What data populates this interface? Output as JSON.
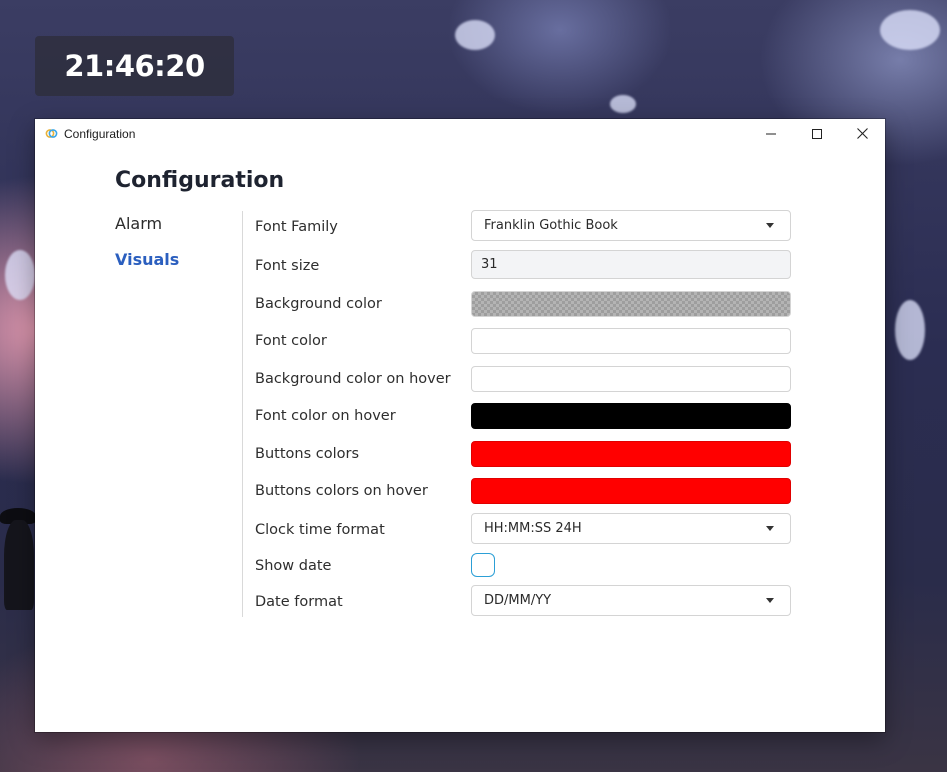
{
  "desktop": {
    "clock_overlay": "21:46:20"
  },
  "window": {
    "title": "Configuration",
    "app_icon": "link-rings-icon",
    "controls": [
      "minimize-icon",
      "maximize-icon",
      "close-icon"
    ]
  },
  "page": {
    "title": "Configuration"
  },
  "nav": {
    "items": [
      {
        "label": "Alarm",
        "active": false
      },
      {
        "label": "Visuals",
        "active": true
      }
    ],
    "active_color": "#2b5fbf"
  },
  "settings": {
    "font_family": {
      "label": "Font Family",
      "value": "Franklin Gothic Book"
    },
    "font_size": {
      "label": "Font size",
      "value": "31"
    },
    "background_color": {
      "label": "Background color",
      "color": "transparent"
    },
    "font_color": {
      "label": "Font color",
      "color": "#ffffff"
    },
    "background_color_hover": {
      "label": "Background color on hover",
      "color": "#ffffff"
    },
    "font_color_hover": {
      "label": "Font color on hover",
      "color": "#000000"
    },
    "buttons_colors": {
      "label": "Buttons colors",
      "color": "#ff0000"
    },
    "buttons_colors_hover": {
      "label": "Buttons colors on hover",
      "color": "#ff0000"
    },
    "clock_time_format": {
      "label": "Clock time format",
      "value": "HH:MM:SS 24H"
    },
    "show_date": {
      "label": "Show date",
      "checked": false
    },
    "date_format": {
      "label": "Date format",
      "value": "DD/MM/YY"
    }
  }
}
